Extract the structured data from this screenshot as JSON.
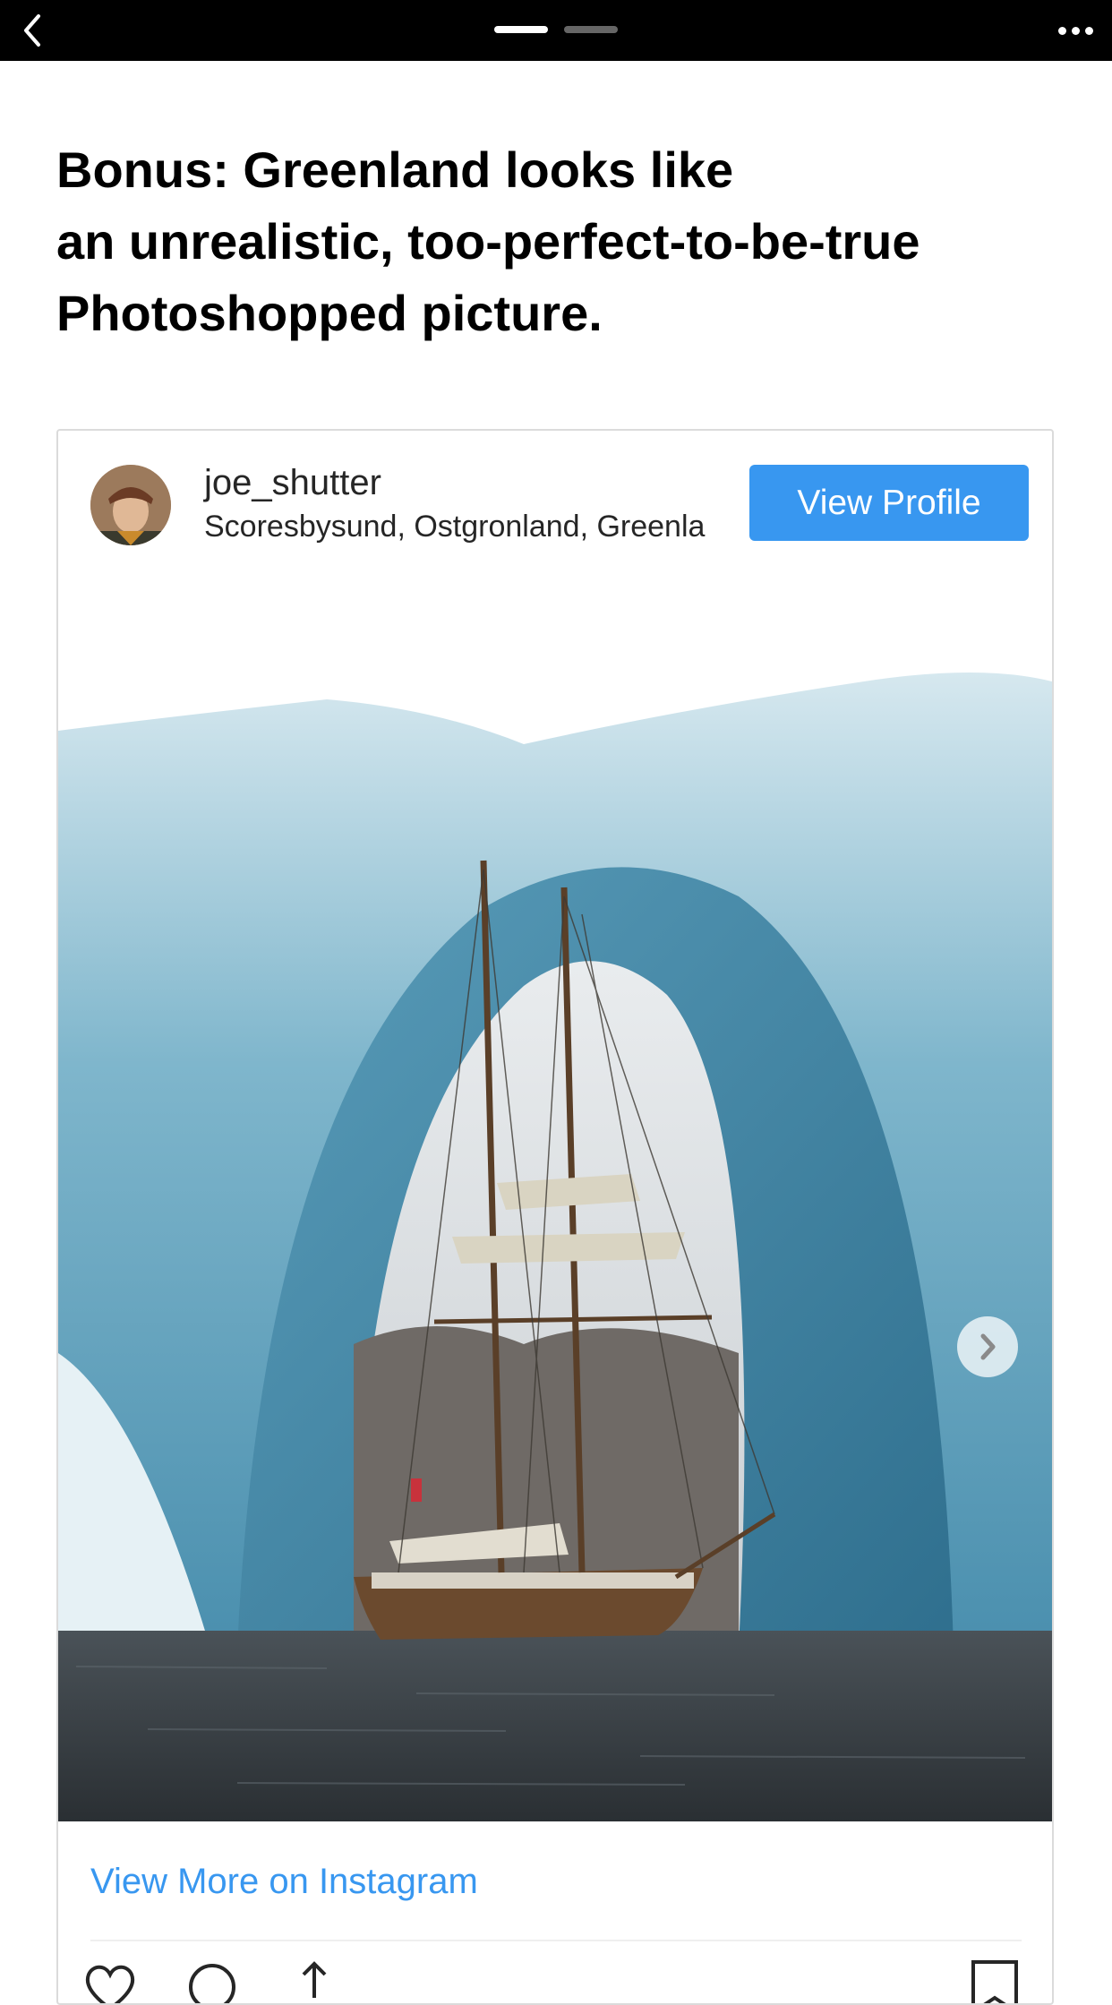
{
  "topbar": {
    "back_icon": "chevron-left-icon",
    "more_icon": "ellipsis-icon",
    "page_indicator": {
      "count": 2,
      "active": 0
    }
  },
  "article": {
    "headline_lines": [
      "Bonus: Greenland looks like",
      "an unrealistic, too-perfect-to-be-true",
      "Photoshopped picture."
    ]
  },
  "embed": {
    "username": "joe_shutter",
    "location": "Scoresbysund, Ostgronland, Greenland",
    "view_profile_label": "View Profile",
    "view_more_label": "View More on Instagram",
    "carousel": {
      "count": 2,
      "active": 0
    },
    "actions": [
      "heart-icon",
      "comment-icon",
      "share-icon",
      "bookmark-icon"
    ],
    "colors": {
      "accent": "#3897f0",
      "border": "#dbdbdb",
      "text": "#262626"
    }
  }
}
